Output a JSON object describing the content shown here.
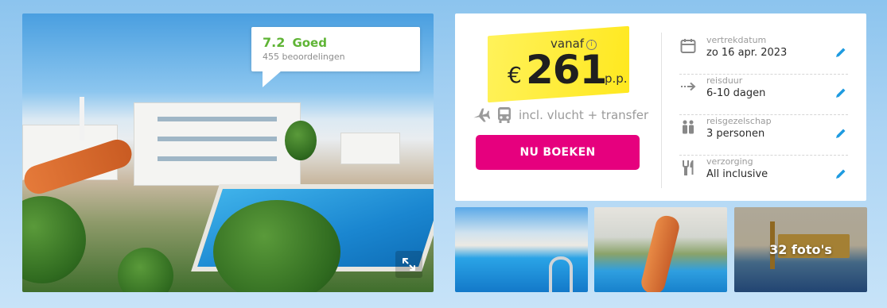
{
  "rating": {
    "score": "7.2",
    "word": "Goed",
    "reviews": "455 beoordelingen"
  },
  "price": {
    "from_label": "vanaf",
    "currency": "€",
    "amount": "261",
    "per_person": "p.p.",
    "includes": "incl. vlucht + transfer"
  },
  "cta": {
    "label": "NU BOEKEN",
    "color": "#e6007e"
  },
  "details": [
    {
      "label": "vertrekdatum",
      "value": "zo 16 apr. 2023",
      "icon": "calendar-icon"
    },
    {
      "label": "reisduur",
      "value": "6-10 dagen",
      "icon": "arrow-right-icon"
    },
    {
      "label": "reisgezelschap",
      "value": "3 personen",
      "icon": "people-icon"
    },
    {
      "label": "verzorging",
      "value": "All inclusive",
      "icon": "cutlery-icon"
    }
  ],
  "gallery": {
    "photo_count_label": "32 foto's"
  },
  "colors": {
    "rating_green": "#5fb435",
    "highlight_yellow": "#ffe81f",
    "edit_blue": "#1e9be0"
  }
}
